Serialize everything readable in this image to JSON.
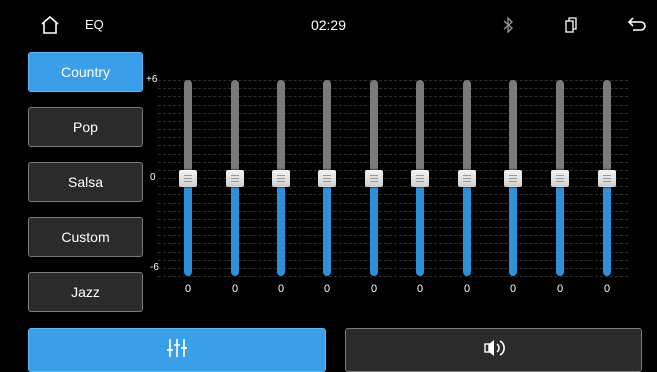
{
  "header": {
    "title": "EQ",
    "time": "02:29",
    "icons": [
      "home-icon",
      "bluetooth-icon",
      "phone-link-icon",
      "back-icon"
    ]
  },
  "presets": [
    {
      "label": "Country",
      "active": true
    },
    {
      "label": "Pop",
      "active": false
    },
    {
      "label": "Salsa",
      "active": false
    },
    {
      "label": "Custom",
      "active": false
    },
    {
      "label": "Jazz",
      "active": false
    }
  ],
  "scale": {
    "max_label": "+6",
    "mid_label": "0",
    "min_label": "-6"
  },
  "bands": [
    {
      "value": "0"
    },
    {
      "value": "0"
    },
    {
      "value": "0"
    },
    {
      "value": "0"
    },
    {
      "value": "0"
    },
    {
      "value": "0"
    },
    {
      "value": "0"
    },
    {
      "value": "0"
    },
    {
      "value": "0"
    },
    {
      "value": "0"
    }
  ],
  "bottom_tabs": [
    {
      "icon": "equalizer-sliders-icon",
      "active": true
    },
    {
      "icon": "speaker-balance-icon",
      "active": false
    }
  ],
  "colors": {
    "accent": "#3a9ee8",
    "slider_fill": "#2f8fd9",
    "track": "#7a7a7a",
    "button_bg": "#2b2b2b"
  }
}
